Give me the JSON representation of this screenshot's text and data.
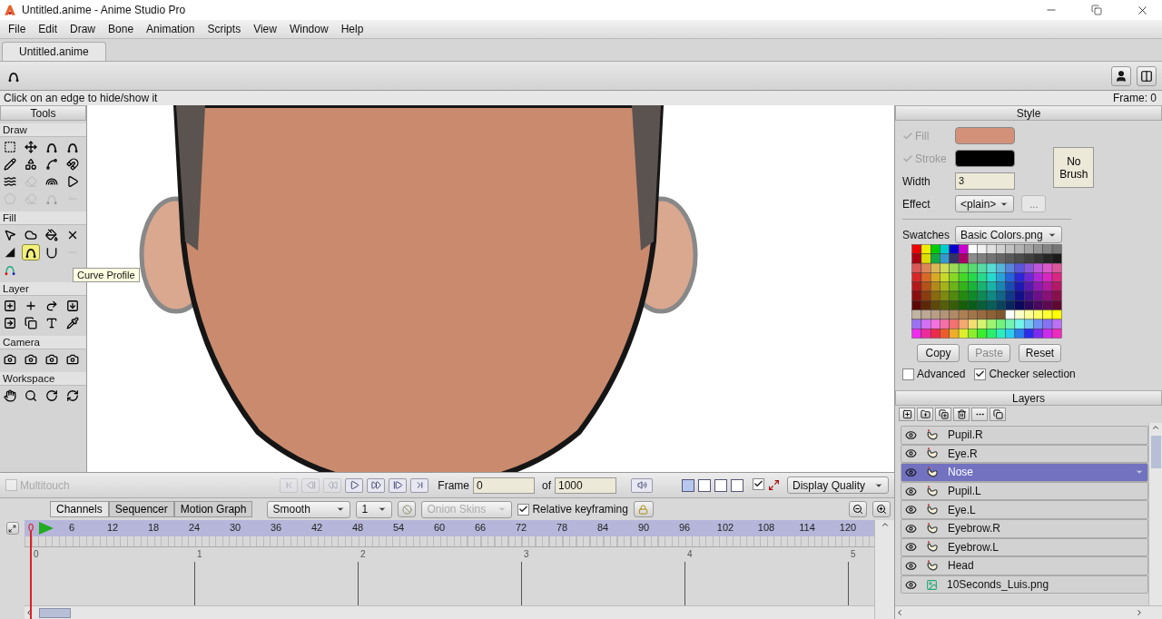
{
  "window": {
    "title": "Untitled.anime - Anime Studio Pro"
  },
  "menu": [
    "File",
    "Edit",
    "Draw",
    "Bone",
    "Animation",
    "Scripts",
    "View",
    "Window",
    "Help"
  ],
  "document_tabs": [
    {
      "label": "Untitled.anime",
      "selected": true
    }
  ],
  "status": {
    "hint": "Click on an edge to hide/show it",
    "frame": "Frame: 0"
  },
  "tools": {
    "title": "Tools",
    "sections": [
      {
        "label": "Draw",
        "items": [
          {
            "selected": false,
            "disabled": false
          },
          {
            "selected": false,
            "disabled": false
          },
          {
            "selected": false,
            "disabled": false
          },
          {
            "selected": false,
            "disabled": false
          },
          {
            "selected": false,
            "disabled": false
          },
          {
            "selected": false,
            "disabled": false
          },
          {
            "selected": false,
            "disabled": false
          },
          {
            "selected": false,
            "disabled": false
          },
          {
            "selected": false,
            "disabled": false
          },
          {
            "selected": false,
            "disabled": true
          },
          {
            "selected": false,
            "disabled": false
          },
          {
            "selected": false,
            "disabled": false
          },
          {
            "selected": false,
            "disabled": true
          },
          {
            "selected": false,
            "disabled": true
          },
          {
            "selected": false,
            "disabled": true
          },
          {
            "selected": false,
            "disabled": true
          }
        ]
      },
      {
        "label": "Fill",
        "items": [
          {
            "selected": false,
            "disabled": false
          },
          {
            "selected": false,
            "disabled": false
          },
          {
            "selected": false,
            "disabled": false
          },
          {
            "selected": false,
            "disabled": false
          },
          {
            "selected": false,
            "disabled": false
          },
          {
            "selected": true,
            "disabled": false
          },
          {
            "selected": false,
            "disabled": false
          },
          {
            "selected": false,
            "disabled": true
          },
          {
            "selected": false,
            "disabled": false
          }
        ]
      },
      {
        "label": "Layer",
        "items": [
          {
            "selected": false,
            "disabled": false
          },
          {
            "selected": false,
            "disabled": false
          },
          {
            "selected": false,
            "disabled": false
          },
          {
            "selected": false,
            "disabled": false
          },
          {
            "selected": false,
            "disabled": false
          },
          {
            "selected": false,
            "disabled": false
          },
          {
            "selected": false,
            "disabled": false
          },
          {
            "selected": false,
            "disabled": false
          }
        ]
      },
      {
        "label": "Camera",
        "items": [
          {
            "selected": false,
            "disabled": false
          },
          {
            "selected": false,
            "disabled": false
          },
          {
            "selected": false,
            "disabled": false
          },
          {
            "selected": false,
            "disabled": false
          }
        ]
      },
      {
        "label": "Workspace",
        "items": [
          {
            "selected": false,
            "disabled": false
          },
          {
            "selected": false,
            "disabled": false
          },
          {
            "selected": false,
            "disabled": false
          },
          {
            "selected": false,
            "disabled": false
          }
        ]
      }
    ]
  },
  "tooltip": "Curve Profile",
  "style": {
    "title": "Style",
    "paint": [
      {
        "label": "Fill",
        "checked": true,
        "color": "#d4917a"
      },
      {
        "label": "Stroke",
        "checked": true,
        "color": "#000000"
      }
    ],
    "brush_button": "No Brush",
    "width": {
      "label": "Width",
      "value": "3"
    },
    "effect": {
      "label": "Effect",
      "value": "<plain>"
    },
    "effect_more": "...",
    "swatches": {
      "label": "Swatches",
      "value": "Basic Colors.png"
    },
    "buttons": [
      {
        "label": "Copy",
        "disabled": false
      },
      {
        "label": "Paste",
        "disabled": true
      },
      {
        "label": "Reset",
        "disabled": false
      }
    ],
    "options": [
      {
        "label": "Advanced",
        "checked": false
      },
      {
        "label": "Checker selection",
        "checked": true
      }
    ]
  },
  "layers": {
    "title": "Layers",
    "items": [
      {
        "name": "Pupil.R",
        "kind": "vector",
        "selected": false
      },
      {
        "name": "Eye.R",
        "kind": "vector",
        "selected": false
      },
      {
        "name": "Nose",
        "kind": "vector",
        "selected": true
      },
      {
        "name": "Pupil.L",
        "kind": "vector",
        "selected": false
      },
      {
        "name": "Eye.L",
        "kind": "vector",
        "selected": false
      },
      {
        "name": "Eyebrow.R",
        "kind": "vector",
        "selected": false
      },
      {
        "name": "Eyebrow.L",
        "kind": "vector",
        "selected": false
      },
      {
        "name": "Head",
        "kind": "vector",
        "selected": false
      },
      {
        "name": "10Seconds_Luis.png",
        "kind": "image",
        "selected": false
      }
    ]
  },
  "playback": {
    "multitouch": {
      "label": "Multitouch",
      "checked": false,
      "disabled": true
    },
    "buttons": [
      {
        "disabled": true
      },
      {
        "disabled": true
      },
      {
        "disabled": true
      },
      {
        "disabled": false
      },
      {
        "disabled": false
      },
      {
        "disabled": false
      },
      {
        "disabled": false
      }
    ],
    "frame_label": "Frame",
    "frame": "0",
    "of_label": "of",
    "total": "1000",
    "view_layouts": [
      {
        "selected": true
      },
      {
        "selected": false
      },
      {
        "selected": false
      },
      {
        "selected": false
      }
    ],
    "show_frame_border": {
      "checked": true
    },
    "display_quality": "Display Quality"
  },
  "timeline": {
    "tabs": [
      {
        "label": "Channels",
        "selected": true
      },
      {
        "label": "Sequencer",
        "selected": false
      },
      {
        "label": "Motion Graph",
        "selected": false
      }
    ],
    "interpolation": "Smooth",
    "step": "1",
    "onion_skins": {
      "label": "Onion Skins",
      "disabled": true
    },
    "relative_keyframing": {
      "label": "Relative keyframing",
      "checked": true
    },
    "frame_ticks": [
      "0",
      "6",
      "12",
      "18",
      "24",
      "30",
      "36",
      "42",
      "48",
      "54",
      "60",
      "66",
      "72",
      "78",
      "84",
      "90",
      "96",
      "102",
      "108",
      "114",
      "120"
    ],
    "second_marks": [
      "0",
      "1",
      "2",
      "3",
      "4",
      "5"
    ]
  }
}
